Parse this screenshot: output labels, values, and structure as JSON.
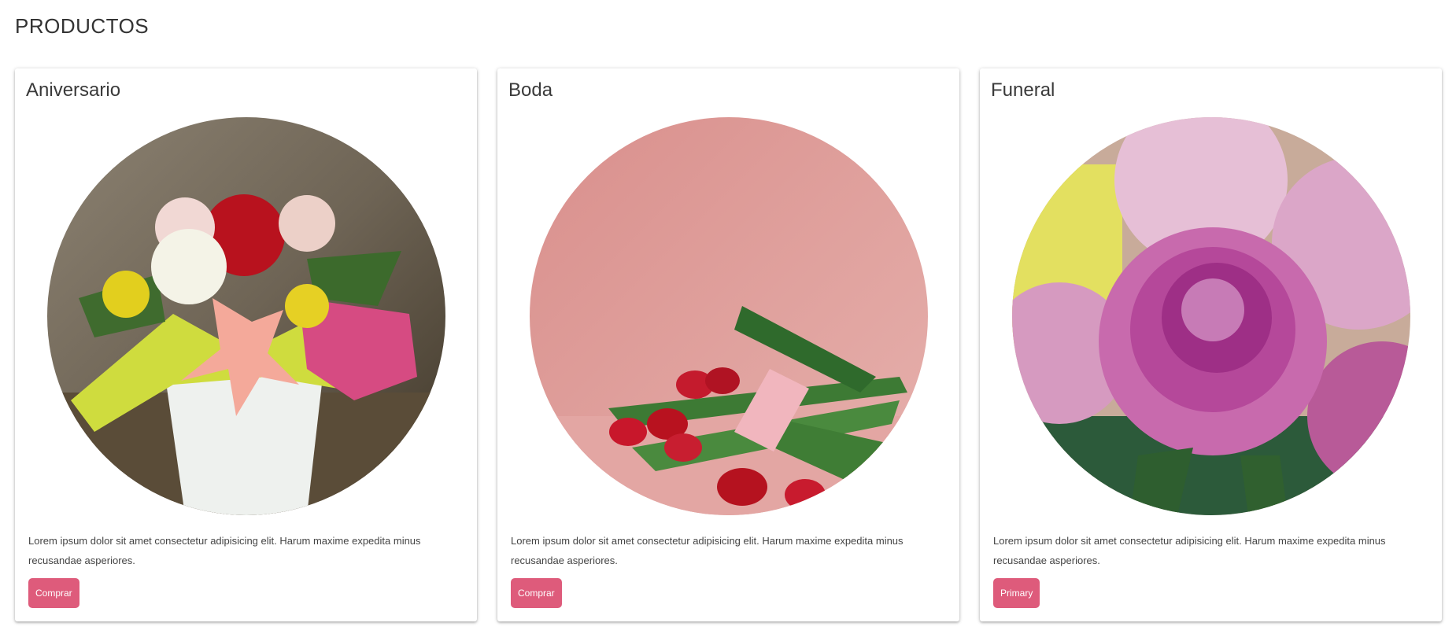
{
  "page": {
    "title": "PRODUCTOS"
  },
  "products": [
    {
      "title": "Aniversario",
      "description": "Lorem ipsum dolor sit amet consectetur adipisicing elit. Harum maxime expedita minus recusandae asperiores.",
      "button_label": "Comprar",
      "image_icon": "bouquet-in-vase-image"
    },
    {
      "title": "Boda",
      "description": "Lorem ipsum dolor sit amet consectetur adipisicing elit. Harum maxime expedita minus recusandae asperiores.",
      "button_label": "Comprar",
      "image_icon": "tulips-on-pink-image"
    },
    {
      "title": "Funeral",
      "description": "Lorem ipsum dolor sit amet consectetur adipisicing elit. Harum maxime expedita minus recusandae asperiores.",
      "button_label": "Primary",
      "image_icon": "peonies-image"
    }
  ],
  "colors": {
    "button": "#de5b7b",
    "card_background": "#ffffff"
  }
}
